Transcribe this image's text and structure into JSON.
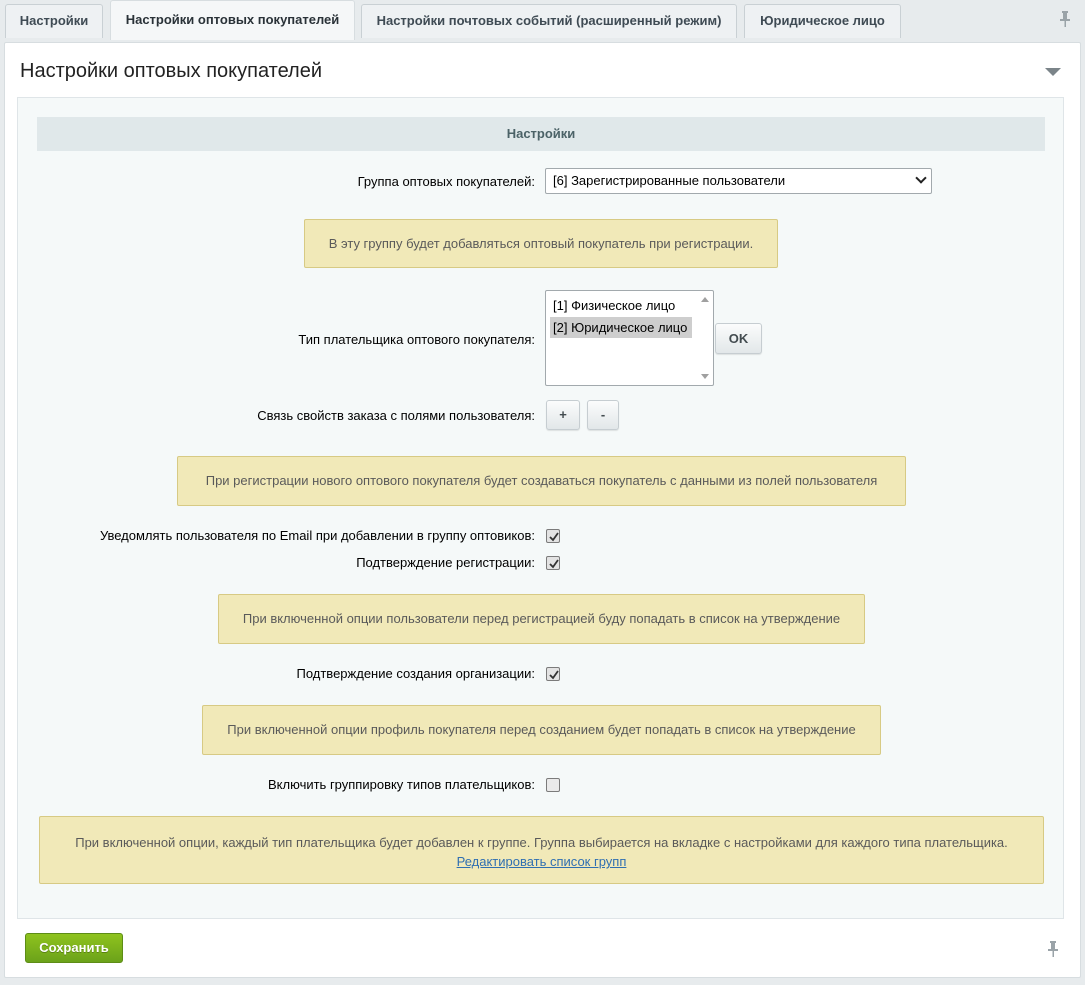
{
  "tabs": [
    {
      "label": "Настройки"
    },
    {
      "label": "Настройки оптовых покупателей"
    },
    {
      "label": "Настройки почтовых событий (расширенный режим)"
    },
    {
      "label": "Юридическое лицо"
    }
  ],
  "panel": {
    "title": "Настройки оптовых покупателей",
    "section_header": "Настройки"
  },
  "wholesale_group": {
    "label": "Группа оптовых покупателей:",
    "selected": "[6] Зарегистрированные пользователи",
    "note": "В эту группу будет добавляться оптовый покупатель при регистрации."
  },
  "payer_type": {
    "label": "Тип плательщика оптового покупателя:",
    "options": [
      "[1] Физическое лицо",
      "[2] Юридическое лицо"
    ],
    "selected_index": 1,
    "ok_label": "OK"
  },
  "order_props": {
    "label": "Связь свойств заказа с полями пользователя:",
    "plus_label": "+",
    "minus_label": "-",
    "note": "При регистрации нового оптового покупателя будет создаваться покупатель с данными из полей пользователя"
  },
  "notify_email": {
    "label": "Уведомлять пользователя по Email при добавлении в группу оптовиков:",
    "checked": true
  },
  "confirm_registration": {
    "label": "Подтверждение регистрации:",
    "checked": true,
    "note": "При включенной опции пользователи перед регистрацией буду попадать в список на утверждение"
  },
  "confirm_org": {
    "label": "Подтверждение создания организации:",
    "checked": true,
    "note": "При включенной опции профиль покупателя перед созданием будет попадать в список на утверждение"
  },
  "group_payer_types": {
    "label": "Включить группировку типов плательщиков:",
    "checked": false,
    "note": "При включенной опции, каждый тип плательщика будет добавлен к группе. Группа выбирается на вкладке с настройками для каждого типа плательщика.",
    "link": "Редактировать список групп"
  },
  "footer": {
    "save_label": "Сохранить"
  },
  "icons": {
    "pin": "pin-icon",
    "collapse": "collapse-arrow-icon",
    "checkmark": "checkmark-icon"
  }
}
